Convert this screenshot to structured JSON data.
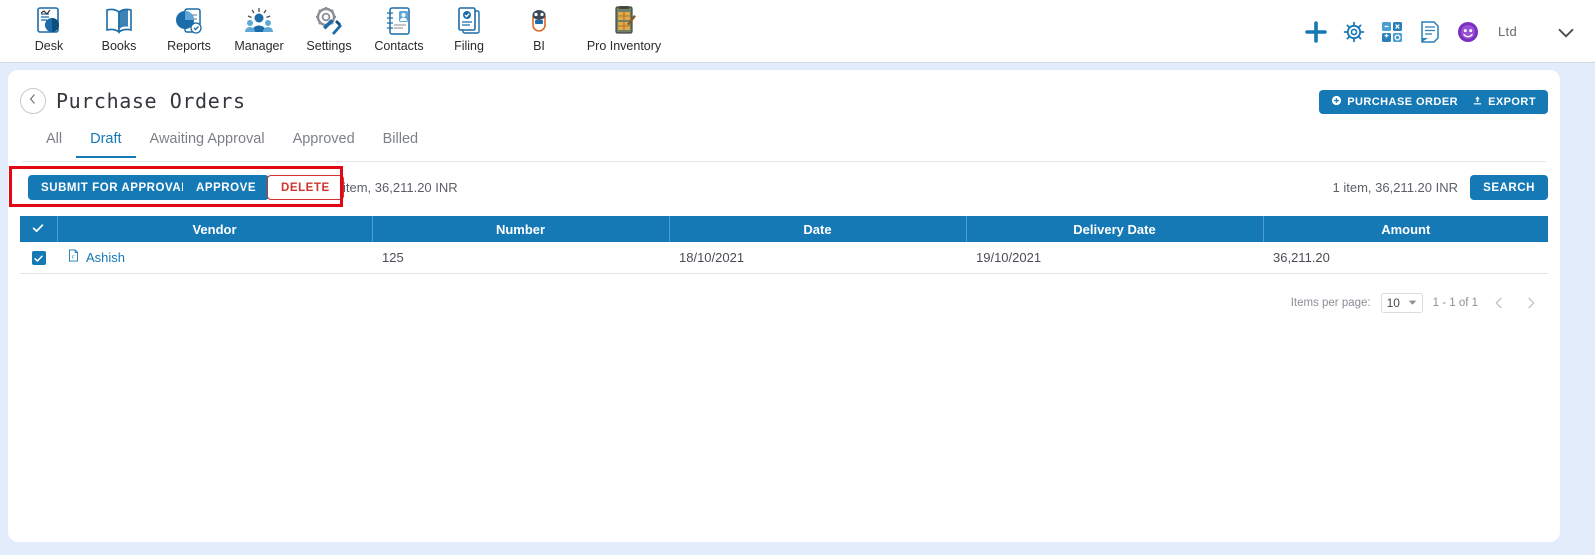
{
  "topnav": {
    "apps": [
      {
        "label": "Desk",
        "icon": "desk-icon"
      },
      {
        "label": "Books",
        "icon": "books-icon"
      },
      {
        "label": "Reports",
        "icon": "reports-icon"
      },
      {
        "label": "Manager",
        "icon": "manager-icon"
      },
      {
        "label": "Settings",
        "icon": "settings-icon"
      },
      {
        "label": "Contacts",
        "icon": "contacts-icon"
      },
      {
        "label": "Filing",
        "icon": "filing-icon"
      },
      {
        "label": "BI",
        "icon": "bi-icon"
      },
      {
        "label": "Pro Inventory",
        "icon": "pro-inventory-icon"
      }
    ],
    "right_icons": [
      "plus-icon",
      "gear-icon",
      "apps-grid-icon",
      "notes-icon",
      "avatar-icon"
    ],
    "org_label": "Ltd",
    "caret": "chevron-down-icon"
  },
  "header": {
    "back": "chevron-left-icon",
    "title": "Purchase Orders",
    "purchase_order_button": "PURCHASE ORDER",
    "purchase_order_icon": "plus-circle-icon",
    "export_button": "EXPORT",
    "export_icon": "upload-icon"
  },
  "tabs": [
    {
      "label": "All",
      "active": false
    },
    {
      "label": "Draft",
      "active": true
    },
    {
      "label": "Awaiting Approval",
      "active": false
    },
    {
      "label": "Approved",
      "active": false
    },
    {
      "label": "Billed",
      "active": false
    }
  ],
  "actionbar": {
    "submit_label": "SUBMIT FOR APPROVAL",
    "approve_label": "APPROVE",
    "delete_label": "DELETE",
    "count_left": "item, 36,211.20 INR",
    "count_right": "1 item, 36,211.20 INR",
    "search_label": "SEARCH",
    "highlight_color": "#e30613"
  },
  "table": {
    "columns": [
      "",
      "Vendor",
      "Number",
      "Date",
      "Delivery Date",
      "Amount"
    ],
    "header_checked": true,
    "rows": [
      {
        "checked": true,
        "vendor": "Ashish",
        "vendor_icon": "document-icon",
        "number": "125",
        "date": "18/10/2021",
        "delivery_date": "19/10/2021",
        "amount": "36,211.20"
      }
    ]
  },
  "paginator": {
    "items_per_page_label": "Items per page:",
    "items_per_page_value": "10",
    "range_label": "1 - 1 of 1",
    "prev_icon": "chevron-left-icon",
    "next_icon": "chevron-right-icon"
  },
  "colors": {
    "accent": "#1579b5",
    "danger": "#d0342c",
    "page_bg": "#e3ecfb",
    "card_bg": "#ffffff"
  }
}
